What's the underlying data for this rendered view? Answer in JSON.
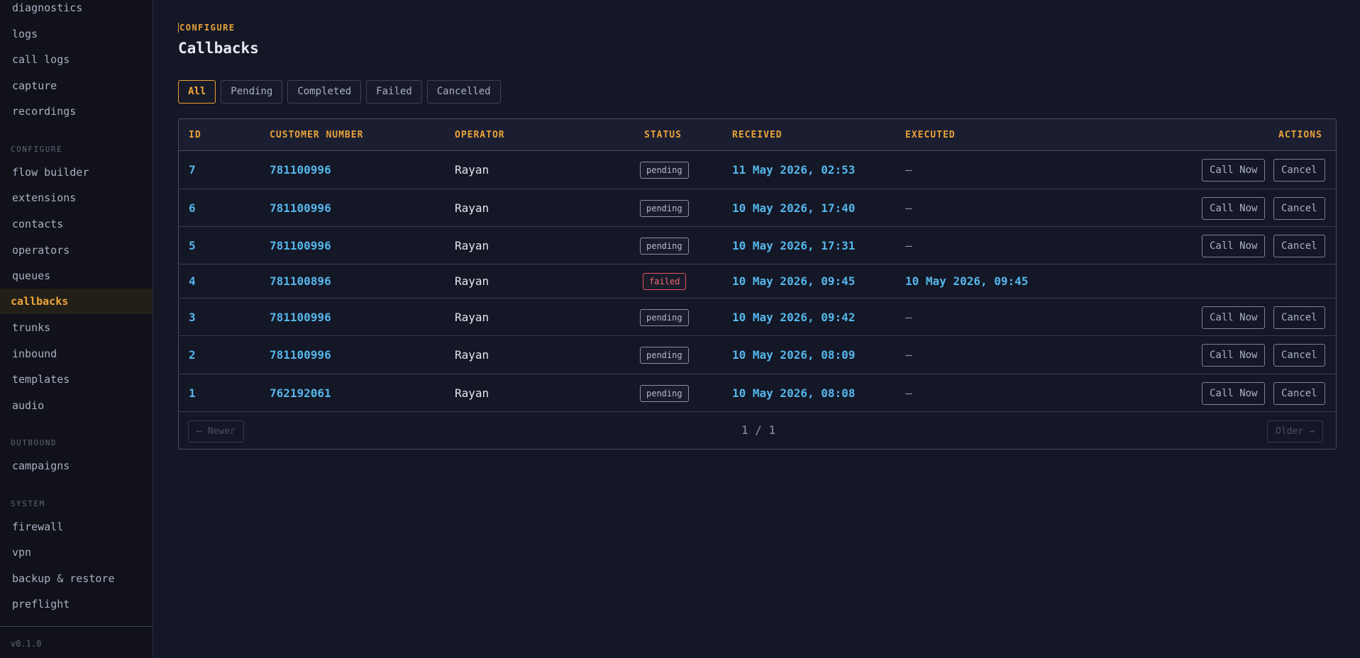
{
  "sidebar": {
    "top_items": [
      {
        "label": "diagnostics"
      },
      {
        "label": "logs"
      },
      {
        "label": "call logs"
      },
      {
        "label": "capture"
      },
      {
        "label": "recordings"
      }
    ],
    "sections": [
      {
        "title": "CONFIGURE",
        "items": [
          {
            "label": "flow builder"
          },
          {
            "label": "extensions"
          },
          {
            "label": "contacts"
          },
          {
            "label": "operators"
          },
          {
            "label": "queues"
          },
          {
            "label": "callbacks",
            "active": true
          },
          {
            "label": "trunks"
          },
          {
            "label": "inbound"
          },
          {
            "label": "templates"
          },
          {
            "label": "audio"
          }
        ]
      },
      {
        "title": "OUTBOUND",
        "items": [
          {
            "label": "campaigns"
          }
        ]
      },
      {
        "title": "SYSTEM",
        "items": [
          {
            "label": "firewall"
          },
          {
            "label": "vpn"
          },
          {
            "label": "backup & restore"
          },
          {
            "label": "preflight"
          }
        ]
      }
    ],
    "version": "v0.1.0"
  },
  "header": {
    "breadcrumb": "CONFIGURE",
    "title": "Callbacks"
  },
  "filters": {
    "tabs": [
      {
        "label": "All",
        "active": true
      },
      {
        "label": "Pending"
      },
      {
        "label": "Completed"
      },
      {
        "label": "Failed"
      },
      {
        "label": "Cancelled"
      }
    ]
  },
  "table": {
    "columns": {
      "id": "ID",
      "number": "CUSTOMER NUMBER",
      "operator": "OPERATOR",
      "status": "STATUS",
      "received": "RECEIVED",
      "executed": "EXECUTED",
      "actions": "ACTIONS"
    },
    "rows": [
      {
        "id": "7",
        "number": "781100996",
        "operator": "Rayan",
        "status": "pending",
        "received": "11 May 2026, 02:53",
        "executed": "—",
        "actions": true
      },
      {
        "id": "6",
        "number": "781100996",
        "operator": "Rayan",
        "status": "pending",
        "received": "10 May 2026, 17:40",
        "executed": "—",
        "actions": true
      },
      {
        "id": "5",
        "number": "781100996",
        "operator": "Rayan",
        "status": "pending",
        "received": "10 May 2026, 17:31",
        "executed": "—",
        "actions": true
      },
      {
        "id": "4",
        "number": "781100896",
        "operator": "Rayan",
        "status": "failed",
        "received": "10 May 2026, 09:45",
        "executed": "10 May 2026, 09:45",
        "actions": false
      },
      {
        "id": "3",
        "number": "781100996",
        "operator": "Rayan",
        "status": "pending",
        "received": "10 May 2026, 09:42",
        "executed": "—",
        "actions": true
      },
      {
        "id": "2",
        "number": "781100996",
        "operator": "Rayan",
        "status": "pending",
        "received": "10 May 2026, 08:09",
        "executed": "—",
        "actions": true
      },
      {
        "id": "1",
        "number": "762192061",
        "operator": "Rayan",
        "status": "pending",
        "received": "10 May 2026, 08:08",
        "executed": "—",
        "actions": true
      }
    ],
    "call_now_label": "Call Now",
    "cancel_label": "Cancel"
  },
  "pager": {
    "newer_label": "← Newer",
    "older_label": "Older →",
    "page_label": "1 / 1"
  },
  "colors": {
    "accent": "#f0a63a",
    "link": "#55b6ea",
    "failed": "#e0525c",
    "background": "#141726"
  }
}
